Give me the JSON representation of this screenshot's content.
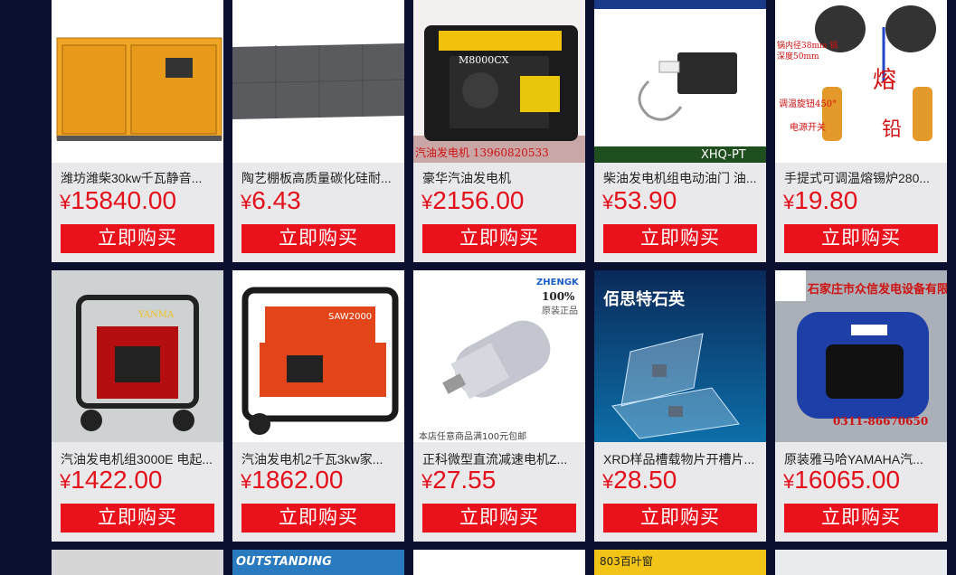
{
  "products": [
    {
      "title": "潍坊潍柴30kw千瓦静音...",
      "currency": "¥",
      "price": "15840.00",
      "buy": "立即购买",
      "img_text": ""
    },
    {
      "title": "陶艺棚板高质量碳化硅耐...",
      "currency": "¥",
      "price": "6.43",
      "buy": "立即购买",
      "img_text": ""
    },
    {
      "title": "豪华汽油发电机",
      "currency": "¥",
      "price": "2156.00",
      "buy": "立即购买",
      "img_text": "汽油发电机   13960820533",
      "img_model": "M8000CX"
    },
    {
      "title": "柴油发电机组电动油门 油...",
      "currency": "¥",
      "price": "53.90",
      "buy": "立即购买",
      "img_text": "XHQ-PT"
    },
    {
      "title": "手提式可调温熔锡炉280...",
      "currency": "¥",
      "price": "19.80",
      "buy": "立即购买",
      "img_text": "熔",
      "img_text2": "铅",
      "img_text3": "锅内径38mm 锅深度50mm",
      "img_text4": "调温旋钮450°",
      "img_text5": "电源开关"
    },
    {
      "title": "汽油发电机组3000E 电起...",
      "currency": "¥",
      "price": "1422.00",
      "buy": "立即购买",
      "img_text": "YANMA"
    },
    {
      "title": "汽油发电机2千瓦3kw家...",
      "currency": "¥",
      "price": "1862.00",
      "buy": "立即购买",
      "img_text": "SAW2000"
    },
    {
      "title": "正科微型直流减速电机Z...",
      "currency": "¥",
      "price": "27.55",
      "buy": "立即购买",
      "img_text": "ZHENGK",
      "img_text2": "100%",
      "img_text3": "原装正品",
      "img_text4": "本店任意商品满100元包邮"
    },
    {
      "title": "XRD样品槽载物片开槽片...",
      "currency": "¥",
      "price": "28.50",
      "buy": "立即购买",
      "img_text": "佰思特石英"
    },
    {
      "title": "原装雅马哈YAMAHA汽...",
      "currency": "¥",
      "price": "16065.00",
      "buy": "立即购买",
      "img_text": "石家庄市众信发电设备有限公司",
      "img_text2": "0311-86670650"
    }
  ],
  "row3": [
    {
      "img_text": ""
    },
    {
      "img_text": "OUTSTANDING"
    },
    {
      "img_text": ""
    },
    {
      "img_text": "803百叶窗"
    },
    {
      "img_text": ""
    }
  ]
}
